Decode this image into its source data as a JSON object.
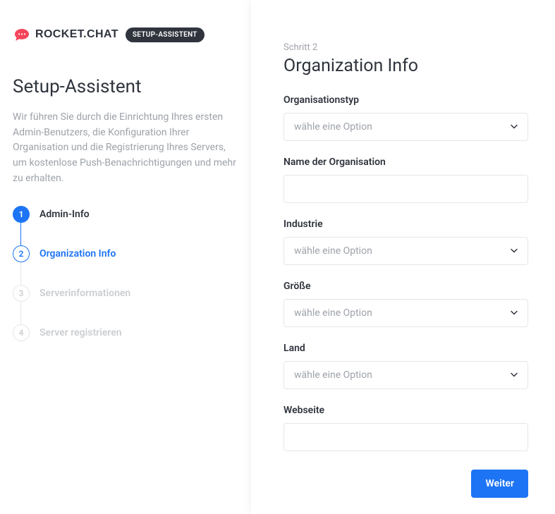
{
  "brand": {
    "name": "ROCKET.CHAT",
    "badge": "SETUP-ASSISTENT"
  },
  "wizard": {
    "title": "Setup-Assistent",
    "description": "Wir führen Sie durch die Einrichtung Ihres ersten Admin-Benutzers, die Konfiguration Ihrer Organisation und die Registrierung Ihres Servers, um kostenlose Push-Benachrichtigungen und mehr zu erhalten.",
    "steps": [
      {
        "num": "1",
        "label": "Admin-Info"
      },
      {
        "num": "2",
        "label": "Organization Info"
      },
      {
        "num": "3",
        "label": "Serverinformationen"
      },
      {
        "num": "4",
        "label": "Server registrieren"
      }
    ]
  },
  "form": {
    "step_indicator": "Schritt 2",
    "heading": "Organization Info",
    "org_type": {
      "label": "Organisationstyp",
      "placeholder": "wähle eine Option"
    },
    "org_name": {
      "label": "Name der Organisation",
      "value": ""
    },
    "industry": {
      "label": "Industrie",
      "placeholder": "wähle eine Option"
    },
    "size": {
      "label": "Größe",
      "placeholder": "wähle eine Option"
    },
    "country": {
      "label": "Land",
      "placeholder": "wähle eine Option"
    },
    "website": {
      "label": "Webseite",
      "value": ""
    },
    "submit": "Weiter"
  }
}
